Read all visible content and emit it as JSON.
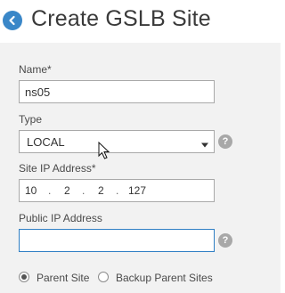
{
  "header": {
    "title": "Create GSLB Site",
    "back_icon": "back-arrow-icon",
    "accent_color": "#3a87c8"
  },
  "form": {
    "name": {
      "label": "Name*",
      "value": "ns05"
    },
    "type": {
      "label": "Type",
      "value": "LOCAL",
      "caret_icon": "caret-down-icon"
    },
    "site_ip": {
      "label": "Site IP Address*",
      "octets": [
        "10",
        "2",
        "2",
        "127"
      ],
      "separator": "."
    },
    "public_ip": {
      "label": "Public IP Address",
      "value": "",
      "focused": true
    },
    "help_icon": "?",
    "site_role": {
      "options": [
        {
          "label": "Parent Site",
          "checked": true
        },
        {
          "label": "Backup Parent Sites",
          "checked": false
        }
      ]
    }
  },
  "colors": {
    "panel_bg": "#f2f2f2",
    "focus_border": "#2f7fc4",
    "help_icon_bg": "#a8a8a8"
  }
}
